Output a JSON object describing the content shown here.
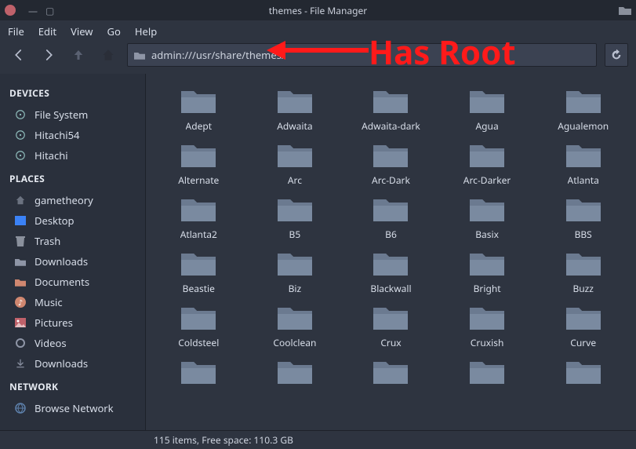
{
  "window": {
    "title": "themes - File Manager"
  },
  "menus": [
    "File",
    "Edit",
    "View",
    "Go",
    "Help"
  ],
  "toolbar": {
    "path_text": "admin:///usr/share/themes/"
  },
  "sidebar": {
    "headers": {
      "devices": "DEVICES",
      "places": "PLACES",
      "network": "NETWORK"
    },
    "devices": [
      {
        "label": "File System",
        "icon": "disk"
      },
      {
        "label": "Hitachi54",
        "icon": "disk"
      },
      {
        "label": "Hitachi",
        "icon": "disk"
      }
    ],
    "places": [
      {
        "label": "gametheory",
        "icon": "home"
      },
      {
        "label": "Desktop",
        "icon": "desktop"
      },
      {
        "label": "Trash",
        "icon": "trash"
      },
      {
        "label": "Downloads",
        "icon": "folder"
      },
      {
        "label": "Documents",
        "icon": "folder-doc"
      },
      {
        "label": "Music",
        "icon": "music"
      },
      {
        "label": "Pictures",
        "icon": "pictures"
      },
      {
        "label": "Videos",
        "icon": "videos"
      },
      {
        "label": "Downloads",
        "icon": "downloads2"
      }
    ],
    "network": [
      {
        "label": "Browse Network",
        "icon": "globe"
      }
    ]
  },
  "folders": [
    "Adept",
    "Adwaita",
    "Adwaita-dark",
    "Agua",
    "Agualemon",
    "Alternate",
    "Arc",
    "Arc-Dark",
    "Arc-Darker",
    "Atlanta",
    "Atlanta2",
    "B5",
    "B6",
    "Basix",
    "BBS",
    "Beastie",
    "Biz",
    "Blackwall",
    "Bright",
    "Buzz",
    "Coldsteel",
    "Coolclean",
    "Crux",
    "Cruxish",
    "Curve",
    "",
    "",
    "",
    "",
    ""
  ],
  "status": "115 items, Free space: 110.3 GB",
  "annotation": {
    "text": "Has Root"
  }
}
